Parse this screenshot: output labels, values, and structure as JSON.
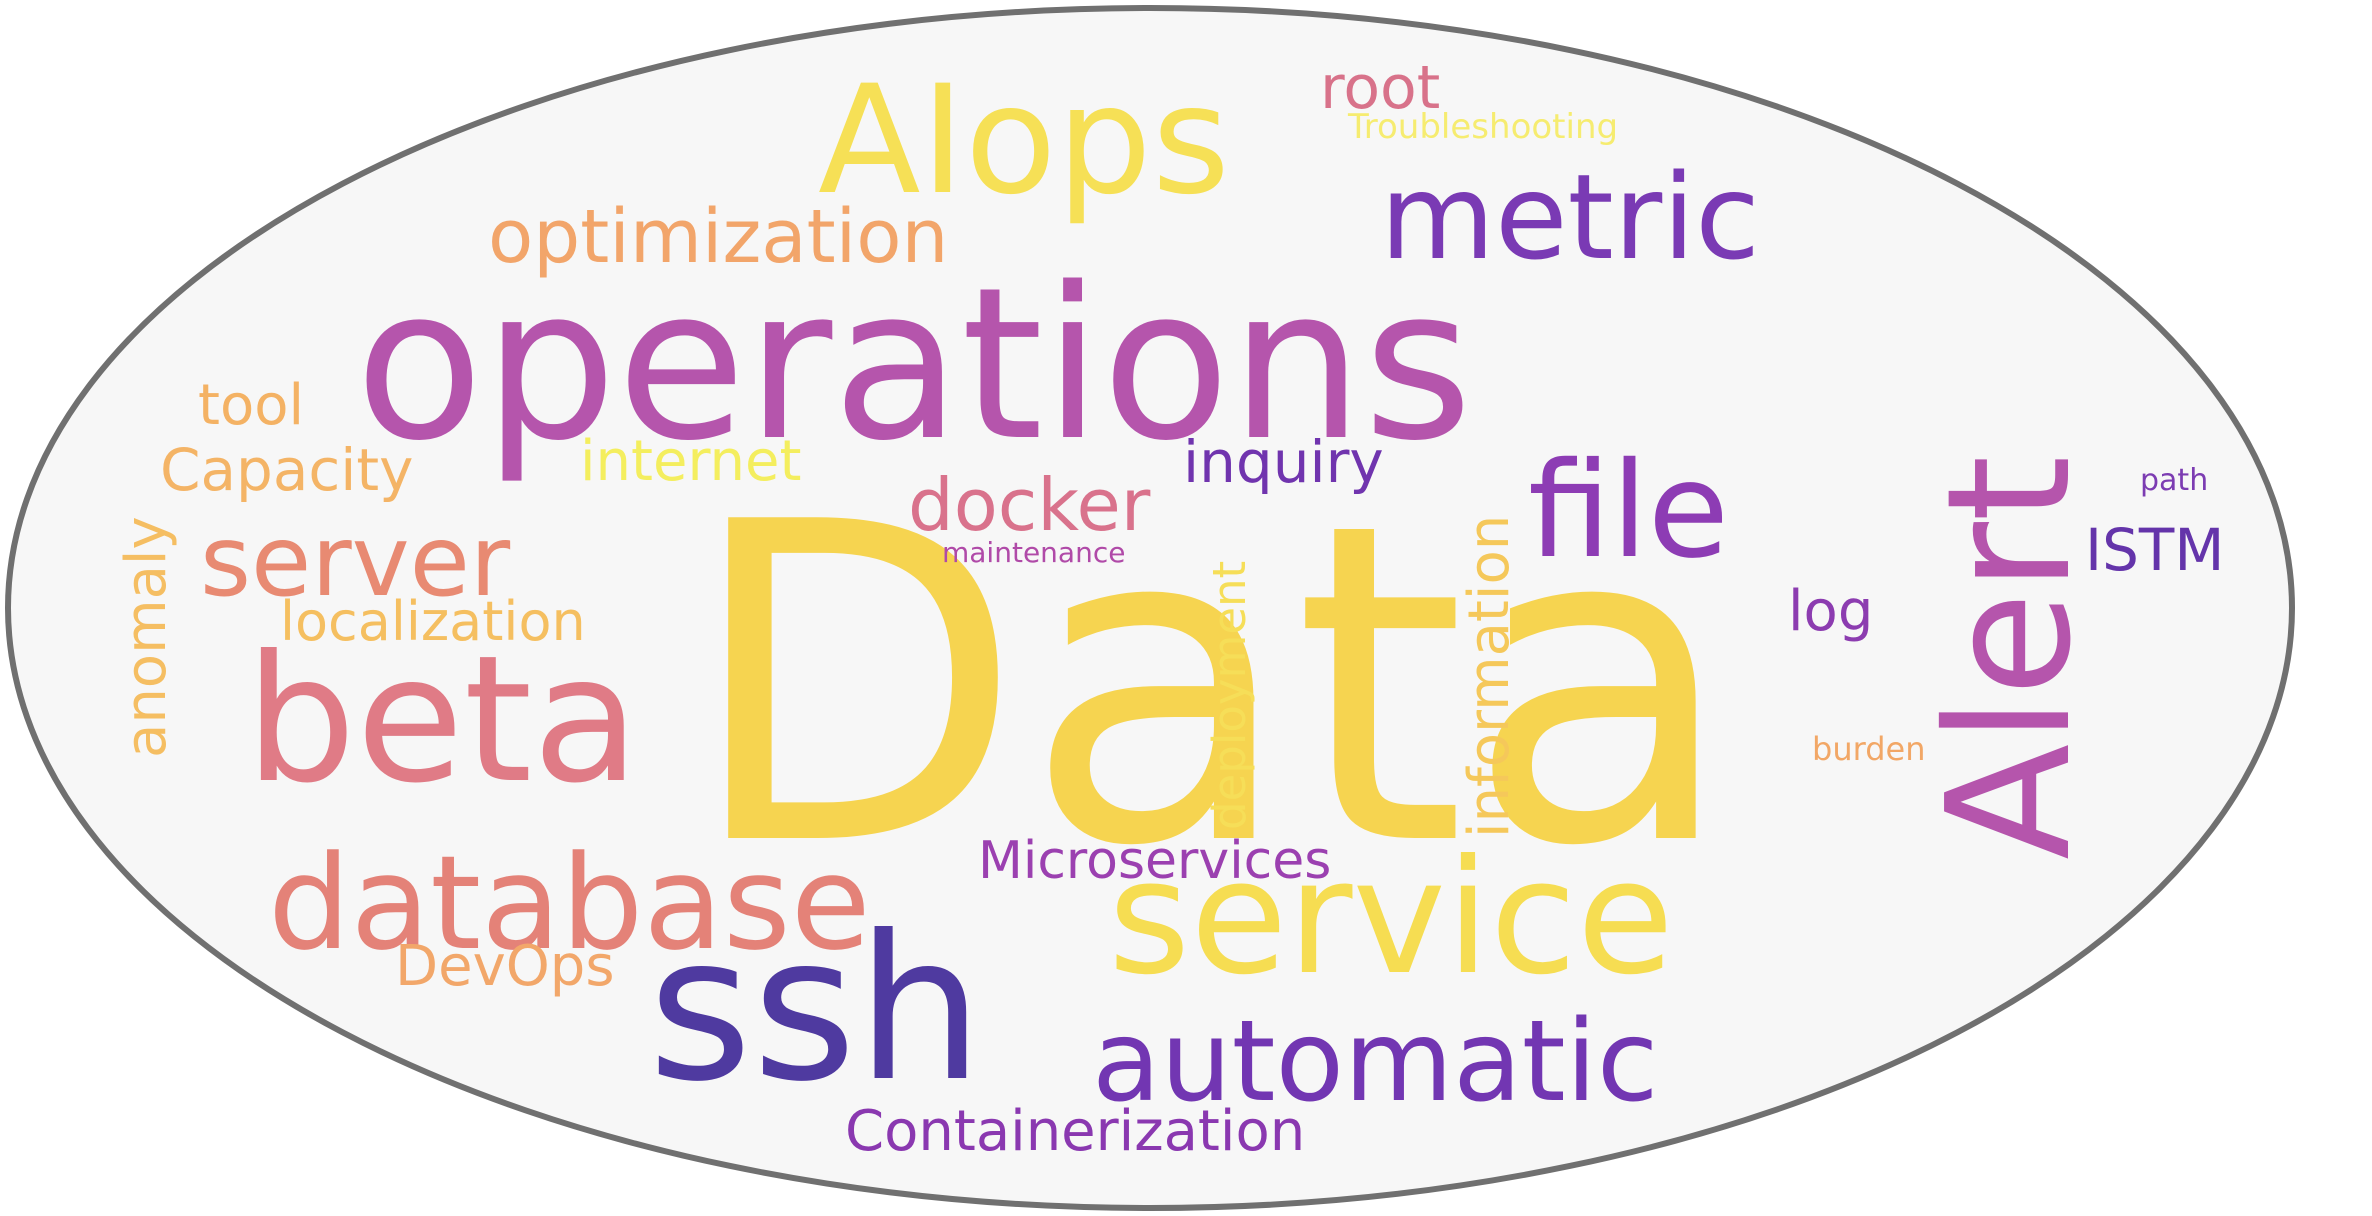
{
  "colors": {
    "background": "#ffffff",
    "ellipse_fill": "#f7f7f7",
    "ellipse_stroke": "#707070"
  },
  "words": {
    "data": {
      "text": "Data",
      "color": "#f6d450"
    },
    "operations": {
      "text": "operations",
      "color": "#b555ac"
    },
    "alert": {
      "text": "Alert",
      "color": "#b555ac"
    },
    "ssh": {
      "text": "ssh",
      "color": "#4f3aa0"
    },
    "service": {
      "text": "service",
      "color": "#f6dd52"
    },
    "beta": {
      "text": "beta",
      "color": "#e07b86"
    },
    "database": {
      "text": "database",
      "color": "#e48278"
    },
    "aiops": {
      "text": "AIops",
      "color": "#f6e056"
    },
    "metric": {
      "text": "metric",
      "color": "#7a3ab4"
    },
    "file": {
      "text": "file",
      "color": "#8d3cb4"
    },
    "automatic": {
      "text": "automatic",
      "color": "#7236b2"
    },
    "server": {
      "text": "server",
      "color": "#e88a72"
    },
    "optimization": {
      "text": "optimization",
      "color": "#f2a56a"
    },
    "docker": {
      "text": "docker",
      "color": "#d9728c"
    },
    "information": {
      "text": "information",
      "color": "#f5c85a"
    },
    "deployment": {
      "text": "deployment",
      "color": "#f6de58"
    },
    "inquiry": {
      "text": "inquiry",
      "color": "#7034ae"
    },
    "internet": {
      "text": "internet",
      "color": "#f4ee5e"
    },
    "capacity": {
      "text": "Capacity",
      "color": "#f4b466"
    },
    "tool": {
      "text": "tool",
      "color": "#f4b264"
    },
    "localization": {
      "text": "localization",
      "color": "#f5bf60"
    },
    "anomaly": {
      "text": "anomaly",
      "color": "#f5be62"
    },
    "microservices": {
      "text": "Microservices",
      "color": "#9b40b0"
    },
    "containerization": {
      "text": "Containerization",
      "color": "#8a38b0"
    },
    "devops": {
      "text": "DevOps",
      "color": "#f2a76a"
    },
    "root": {
      "text": "root",
      "color": "#d8728a"
    },
    "troubleshooting": {
      "text": "Troubleshooting",
      "color": "#f6ec70"
    },
    "istm": {
      "text": "ISTM",
      "color": "#6434aa"
    },
    "log": {
      "text": "log",
      "color": "#8c3cb0"
    },
    "path": {
      "text": "path",
      "color": "#7c3cb2"
    },
    "maintenance": {
      "text": "maintenance",
      "color": "#b04aa8"
    },
    "burden": {
      "text": "burden",
      "color": "#f2a766"
    }
  }
}
